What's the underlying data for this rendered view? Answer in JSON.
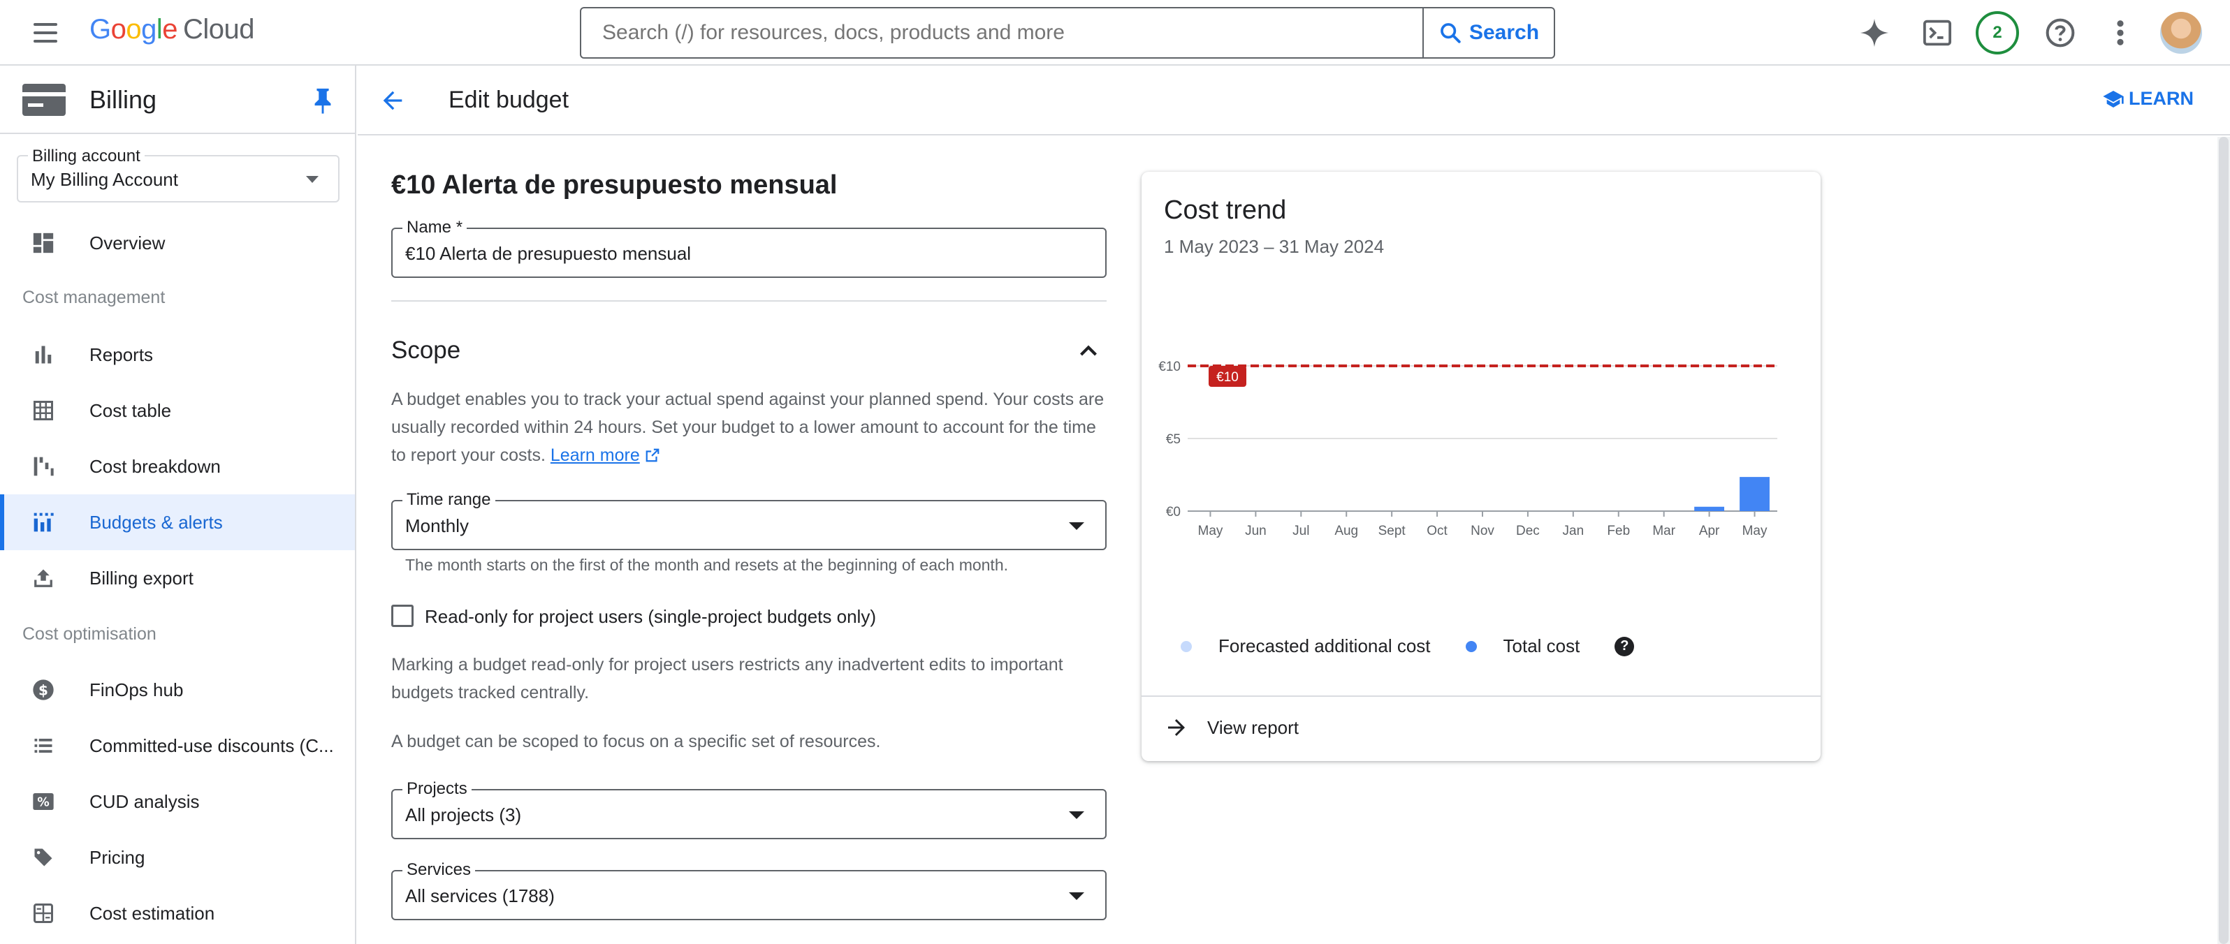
{
  "header": {
    "logo_google": [
      "G",
      "o",
      "o",
      "g",
      "l",
      "e"
    ],
    "logo_cloud": "Cloud",
    "search_placeholder": "Search (/) for resources, docs, products and more",
    "search_button": "Search",
    "notifications_count": "2"
  },
  "sidenav": {
    "title": "Billing",
    "billing_account_label": "Billing account",
    "billing_account_value": "My Billing Account",
    "overview": "Overview",
    "section_cost_management": "Cost management",
    "reports": "Reports",
    "cost_table": "Cost table",
    "cost_breakdown": "Cost breakdown",
    "budgets_alerts": "Budgets & alerts",
    "billing_export": "Billing export",
    "section_cost_optimisation": "Cost optimisation",
    "finops_hub": "FinOps hub",
    "committed_use": "Committed-use discounts (C...",
    "cud_analysis": "CUD analysis",
    "pricing": "Pricing",
    "cost_estimation": "Cost estimation"
  },
  "subbar": {
    "title": "Edit budget",
    "learn": "LEARN"
  },
  "form": {
    "heading": "€10 Alerta de presupuesto mensual",
    "name_label": "Name *",
    "name_value": "€10 Alerta de presupuesto mensual",
    "scope_title": "Scope",
    "scope_desc": "A budget enables you to track your actual spend against your planned spend. Your costs are usually recorded within 24 hours. Set your budget to a lower amount to account for the time to report your costs.",
    "learn_more": "Learn more",
    "time_range_label": "Time range",
    "time_range_value": "Monthly",
    "time_range_hint": "The month starts on the first of the month and resets at the beginning of each month.",
    "readonly_label": "Read-only for project users (single-project budgets only)",
    "readonly_desc": "Marking a budget read-only for project users restricts any inadvertent edits to important budgets tracked centrally.",
    "scoped_desc": "A budget can be scoped to focus on a specific set of resources.",
    "projects_label": "Projects",
    "projects_value": "All projects (3)",
    "services_label": "Services",
    "services_value": "All services (1788)"
  },
  "card": {
    "title": "Cost trend",
    "date_range": "1 May 2023 – 31 May 2024",
    "view_report": "View report"
  },
  "chart_data": {
    "type": "bar",
    "categories": [
      "May",
      "Jun",
      "Jul",
      "Aug",
      "Sept",
      "Oct",
      "Nov",
      "Dec",
      "Jan",
      "Feb",
      "Mar",
      "Apr",
      "May"
    ],
    "series": [
      {
        "name": "Forecasted additional cost",
        "values": [
          0,
          0,
          0,
          0,
          0,
          0,
          0,
          0,
          0,
          0,
          0,
          0,
          0
        ],
        "color": "#c6dafc"
      },
      {
        "name": "Total cost",
        "values": [
          0,
          0,
          0,
          0,
          0,
          0,
          0,
          0,
          0,
          0,
          0,
          0.3,
          2.35
        ],
        "color": "#4285f4"
      }
    ],
    "y_ticks": [
      "€0",
      "€5",
      "€10"
    ],
    "ylim": [
      0,
      10
    ],
    "budget_line": {
      "value": 10,
      "label": "€10",
      "color": "#c5221f"
    }
  },
  "colors": {
    "accent": "#1a73e8",
    "active_bg": "#e8f0fe",
    "budget_red": "#c5221f"
  }
}
